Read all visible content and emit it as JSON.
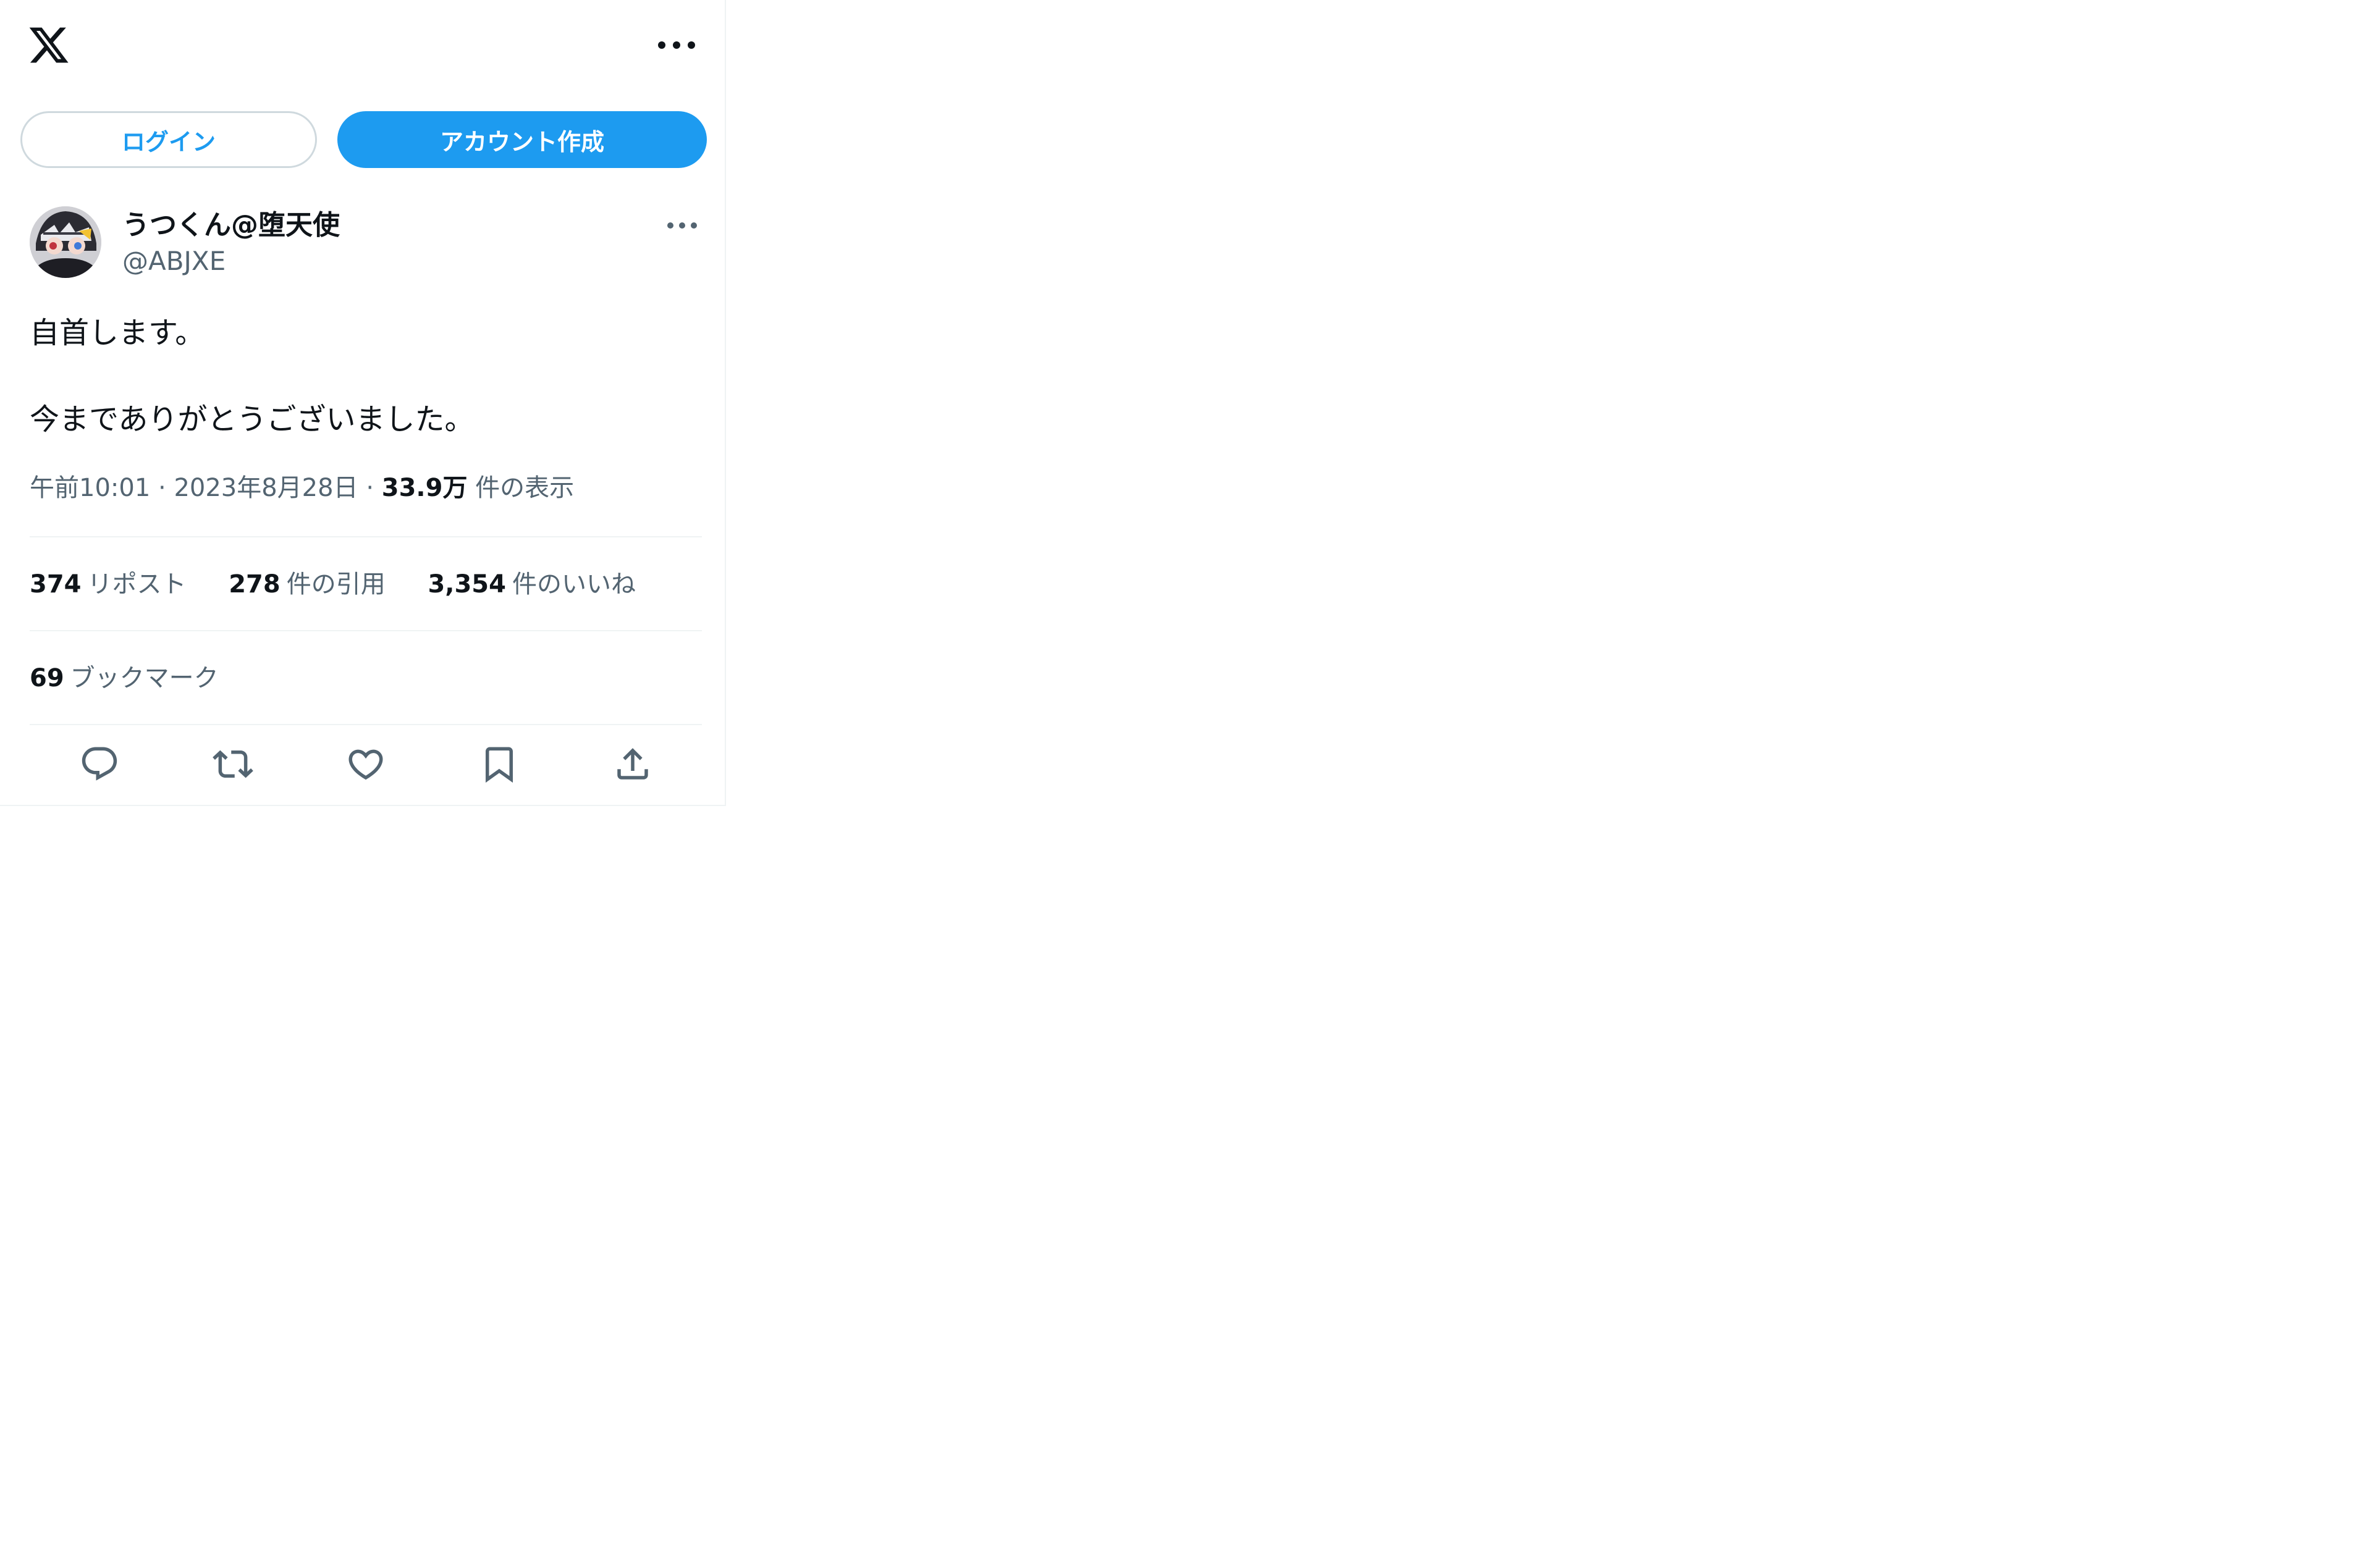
{
  "header": {
    "logo_icon": "x-logo-icon",
    "more_icon": "more-horizontal-icon"
  },
  "auth": {
    "login_label": "ログイン",
    "signup_label": "アカウント作成"
  },
  "post": {
    "author_name": "うつくん@堕天使",
    "author_handle": "@ABJXE",
    "text_line_1": "自首します。",
    "text_line_2": "今までありがとうございました。",
    "time": "午前10:01",
    "separator": "·",
    "date": "2023年8月28日",
    "views_count": "33.9万",
    "views_label": "件の表示"
  },
  "stats": {
    "reposts_count": "374",
    "reposts_label": "リポスト",
    "quotes_count": "278",
    "quotes_label": "件の引用",
    "likes_count": "3,354",
    "likes_label": "件のいいね",
    "bookmarks_count": "69",
    "bookmarks_label": "ブックマーク"
  },
  "actions": [
    {
      "icon": "reply-icon"
    },
    {
      "icon": "repost-icon"
    },
    {
      "icon": "like-icon"
    },
    {
      "icon": "bookmark-icon"
    },
    {
      "icon": "share-icon"
    }
  ],
  "colors": {
    "accent": "#1d9bf0",
    "text_primary": "#0f1419",
    "text_secondary": "#536471",
    "border": "#eff3f4"
  }
}
